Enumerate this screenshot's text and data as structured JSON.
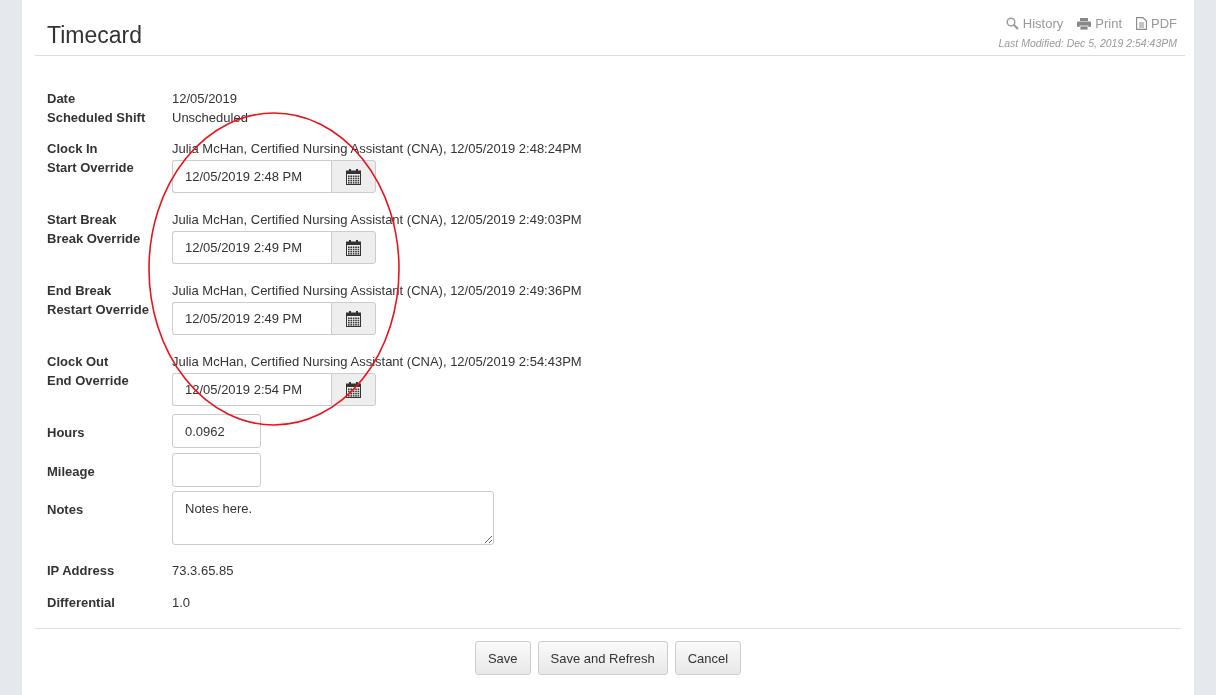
{
  "header": {
    "title": "Timecard",
    "actions": [
      {
        "kind": "history",
        "label": "History"
      },
      {
        "kind": "print",
        "label": "Print"
      },
      {
        "kind": "pdf",
        "label": "PDF"
      }
    ],
    "last_modified": "Last Modified: Dec 5, 2019 2:54:43PM"
  },
  "fields": [
    {
      "kind": "text",
      "label": "Date",
      "value": "12/05/2019"
    },
    {
      "kind": "text",
      "label": "Scheduled Shift",
      "value": "Unscheduled"
    },
    {
      "kind": "override",
      "label": "Clock In",
      "value": "Julia McHan, Certified Nursing Assistant (CNA), 12/05/2019 2:48:24PM",
      "override_label": "Start Override",
      "override_value": "12/05/2019 2:48 PM"
    },
    {
      "kind": "override",
      "label": "Start Break",
      "value": "Julia McHan, Certified Nursing Assistant (CNA), 12/05/2019 2:49:03PM",
      "override_label": "Break Override",
      "override_value": "12/05/2019 2:49 PM"
    },
    {
      "kind": "override",
      "label": "End Break",
      "value": "Julia McHan, Certified Nursing Assistant (CNA), 12/05/2019 2:49:36PM",
      "override_label": "Restart Override",
      "override_value": "12/05/2019 2:49 PM"
    },
    {
      "kind": "override",
      "label": "Clock Out",
      "value": "Julia McHan, Certified Nursing Assistant (CNA), 12/05/2019 2:54:43PM",
      "override_label": "End Override",
      "override_value": "12/05/2019 2:54 PM"
    },
    {
      "kind": "input",
      "label": "Hours",
      "value": "0.0962"
    },
    {
      "kind": "input",
      "label": "Mileage"
    },
    {
      "kind": "textarea",
      "label": "Notes",
      "value": "Notes here."
    },
    {
      "kind": "text",
      "label": "IP Address",
      "value": "73.3.65.85"
    },
    {
      "kind": "text",
      "label": "Differential",
      "value": "1.0"
    }
  ],
  "buttons": [
    "Save",
    "Save and Refresh",
    "Cancel"
  ]
}
